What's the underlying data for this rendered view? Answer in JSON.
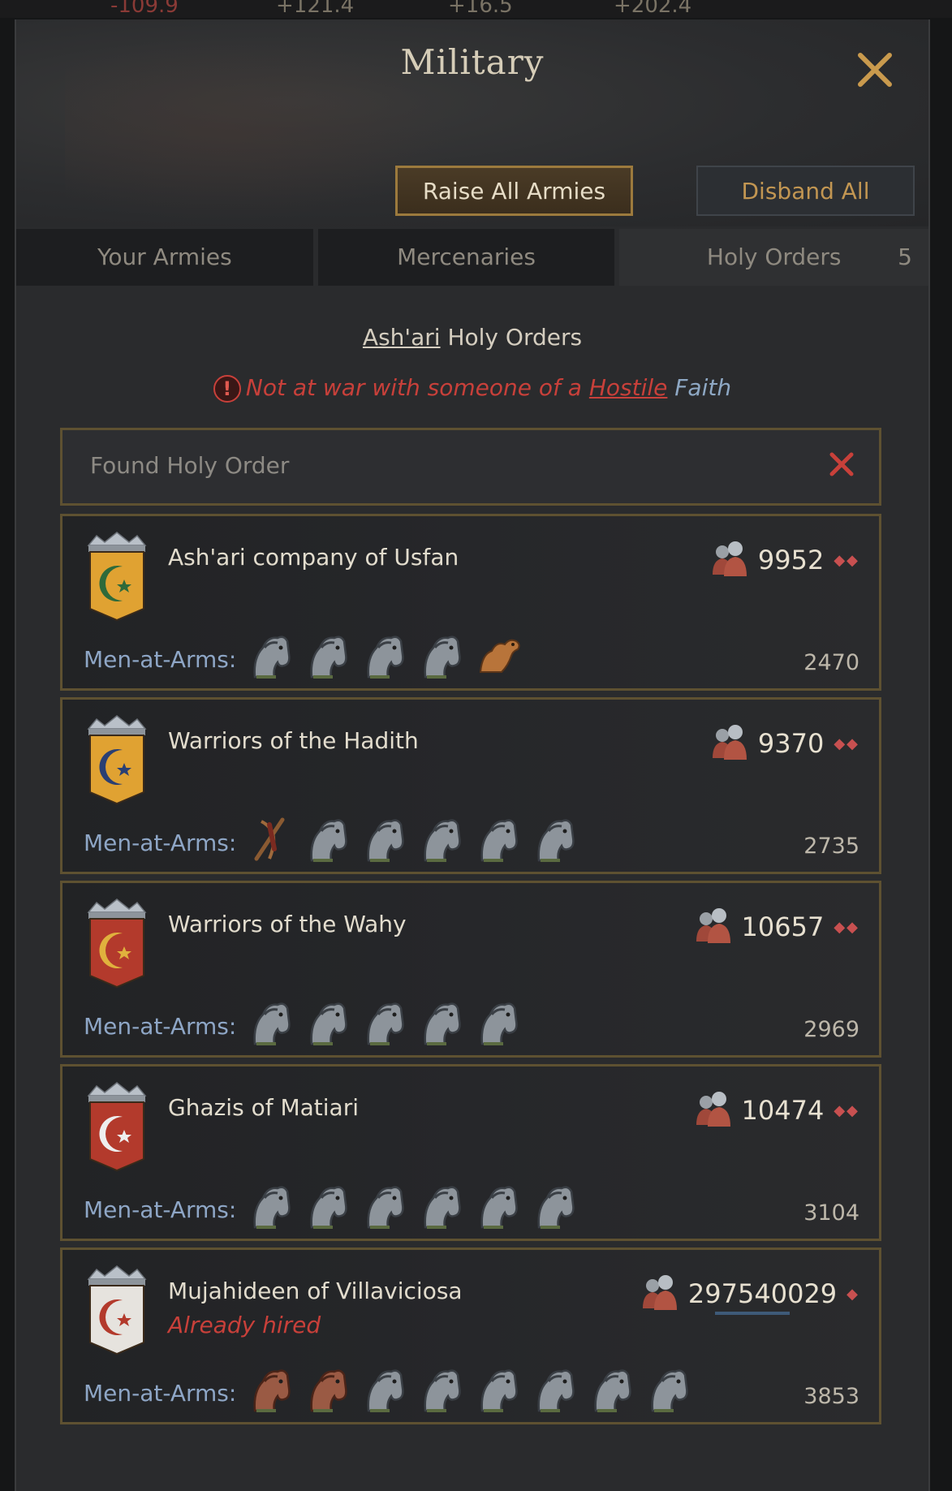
{
  "topbar": {
    "values": [
      "-109.9",
      "+121.4",
      "+16.5",
      "+202.4"
    ]
  },
  "header": {
    "title": "Military",
    "raise_all_label": "Raise All Armies",
    "disband_all_label": "Disband All"
  },
  "tabs": [
    {
      "label": "Your Armies"
    },
    {
      "label": "Mercenaries"
    },
    {
      "label": "Holy Orders",
      "count": "5"
    }
  ],
  "faith": {
    "name": "Ash'ari",
    "suffix": " Holy Orders"
  },
  "warning": {
    "prefix": "Not at war with someone of a ",
    "hostile": "Hostile",
    "faith": " Faith"
  },
  "found_label": "Found Holy Order",
  "men_at_arms_label": "Men-at-Arms:",
  "orders": [
    {
      "name": "Ash'ari company of Usfan",
      "troops": "9952",
      "cost": "2470",
      "banner_color": "#e0a232",
      "moon_color": "#2e6a3a",
      "units": [
        "horse",
        "horse",
        "horse",
        "horse",
        "camel"
      ]
    },
    {
      "name": "Warriors of the Hadith",
      "troops": "9370",
      "cost": "2735",
      "banner_color": "#e0a232",
      "moon_color": "#2a3f73",
      "units": [
        "archer",
        "horse",
        "horse",
        "horse",
        "horse",
        "horse"
      ]
    },
    {
      "name": "Warriors of the Wahy",
      "troops": "10657",
      "cost": "2969",
      "banner_color": "#b33a2c",
      "moon_color": "#e0b13d",
      "units": [
        "horse",
        "horse",
        "horse",
        "horse",
        "horse"
      ]
    },
    {
      "name": "Ghazis of Matiari",
      "troops": "10474",
      "cost": "3104",
      "banner_color": "#b33a2c",
      "moon_color": "#eeeeee",
      "units": [
        "horse",
        "horse",
        "horse",
        "horse",
        "horse",
        "horse"
      ]
    },
    {
      "name": "Mujahideen of Villaviciosa",
      "status": "Already hired",
      "troops": "297540029",
      "cost": "3853",
      "banner_color": "#e6e3de",
      "moon_color": "#b33a2c",
      "units": [
        "horse-red",
        "horse-red",
        "horse",
        "horse",
        "horse",
        "horse",
        "horse",
        "horse"
      ]
    }
  ]
}
